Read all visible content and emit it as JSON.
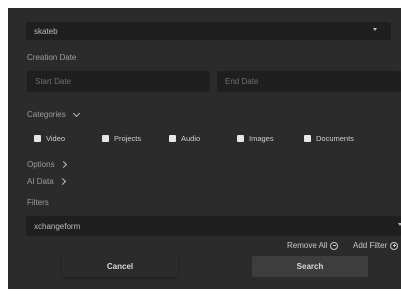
{
  "user_select": {
    "value": "skateb"
  },
  "creation_date": {
    "label": "Creation Date",
    "start_placeholder": "Start Date",
    "end_placeholder": "End Date"
  },
  "categories": {
    "label": "Categories",
    "items": [
      {
        "label": "Video"
      },
      {
        "label": "Projects"
      },
      {
        "label": "Audio"
      },
      {
        "label": "Images"
      },
      {
        "label": "Documents"
      }
    ]
  },
  "options_label": "Options",
  "ai_data_label": "AI Data",
  "filters": {
    "label": "Filters",
    "select_value": "xchangeform",
    "remove_all_label": "Remove All",
    "add_filter_label": "Add Filter"
  },
  "buttons": {
    "cancel": "Cancel",
    "search": "Search"
  },
  "colors": {
    "panel_bg": "#2b2b2b",
    "field_bg": "#1f1f1f",
    "search_btn": "#3d3d3d"
  }
}
